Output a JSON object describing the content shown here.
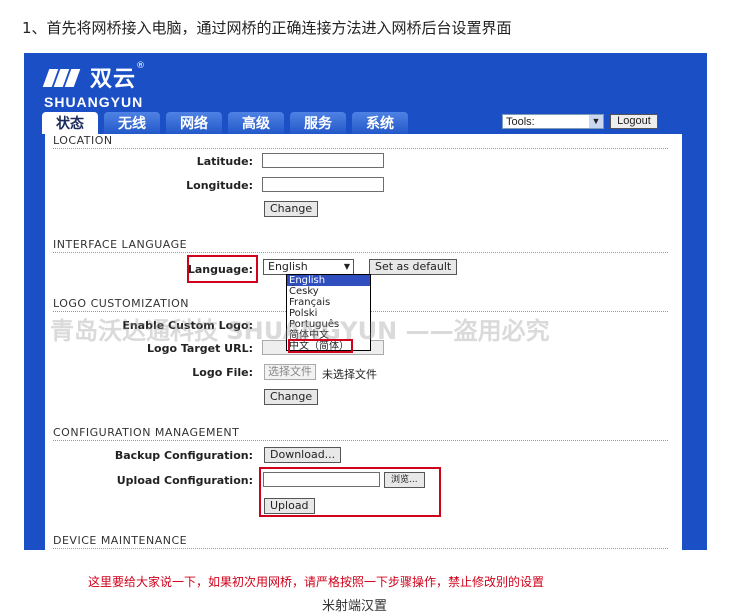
{
  "heading": "1、首先将网桥接入电脑，通过网桥的正确连接方法进入网桥后台设置界面",
  "brand": {
    "name_cn": "双云",
    "reg_mark": "®",
    "name_en": "SHUANGYUN",
    "color": "#1a4fc6"
  },
  "tabs": [
    "状态",
    "无线",
    "网络",
    "高级",
    "服务",
    "系统"
  ],
  "tools": {
    "selected": "Tools:"
  },
  "logout_label": "Logout",
  "sections": {
    "location": {
      "title": "LOCATION",
      "latitude_label": "Latitude:",
      "longitude_label": "Longitude:",
      "change_label": "Change"
    },
    "interface_language": {
      "title": "INTERFACE LANGUAGE",
      "language_label": "Language:",
      "selected": "English",
      "options": [
        "English",
        "Česky",
        "Français",
        "Polski",
        "Português",
        "简体中文",
        "中文（简体）"
      ],
      "set_default_label": "Set as default"
    },
    "logo_customization": {
      "title": "LOGO CUSTOMIZATION",
      "enable_label": "Enable Custom Logo:",
      "target_url_label": "Logo Target URL:",
      "file_label": "Logo File:",
      "choose_file_label": "选择文件",
      "no_file_label": "未选择文件",
      "change_label": "Change"
    },
    "configuration_management": {
      "title": "CONFIGURATION MANAGEMENT",
      "backup_label": "Backup Configuration:",
      "download_label": "Download...",
      "upload_label": "Upload Configuration:",
      "browse_label": "浏览...",
      "upload_button_label": "Upload"
    },
    "device_maintenance": {
      "title": "DEVICE MAINTENANCE"
    }
  },
  "watermark": "青岛沃达通科技 SHUANGYUN ——盗用必究",
  "note": "这里要给大家说一下，如果初次用网桥，请严格按照一下步骤操作，禁止修改别的设置",
  "cutoff_text": "米射端汉置",
  "accent_colors": {
    "highlight": "#d0021b",
    "selection": "#2f4fbf"
  }
}
